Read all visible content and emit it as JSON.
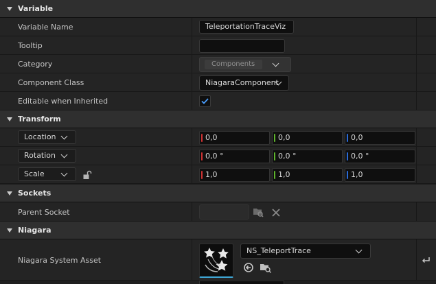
{
  "colors": {
    "x_axis": "#d03232",
    "y_axis": "#5fb52c",
    "z_axis": "#2a6bd8",
    "checkbox_check": "#4a9eff"
  },
  "variable": {
    "title": "Variable",
    "variable_name_label": "Variable Name",
    "variable_name_value": "TeleportationTraceViz",
    "tooltip_label": "Tooltip",
    "tooltip_value": "",
    "category_label": "Category",
    "category_value": "Components",
    "component_class_label": "Component Class",
    "component_class_value": "NiagaraComponent",
    "editable_label": "Editable when Inherited",
    "editable_checked": true
  },
  "transform": {
    "title": "Transform",
    "location": {
      "mode": "Location",
      "x": "0,0",
      "y": "0,0",
      "z": "0,0"
    },
    "rotation": {
      "mode": "Rotation",
      "x": "0,0 °",
      "y": "0,0 °",
      "z": "0,0 °"
    },
    "scale": {
      "mode": "Scale",
      "x": "1,0",
      "y": "1,0",
      "z": "1,0",
      "lock_icon": "unlock-icon"
    }
  },
  "sockets": {
    "title": "Sockets",
    "parent_socket_label": "Parent Socket",
    "parent_socket_value": ""
  },
  "niagara": {
    "title": "Niagara",
    "system_asset_label": "Niagara System Asset",
    "system_asset_value": "NS_TeleportTrace",
    "thumbnail_icon": "niagara-stars-icon"
  }
}
